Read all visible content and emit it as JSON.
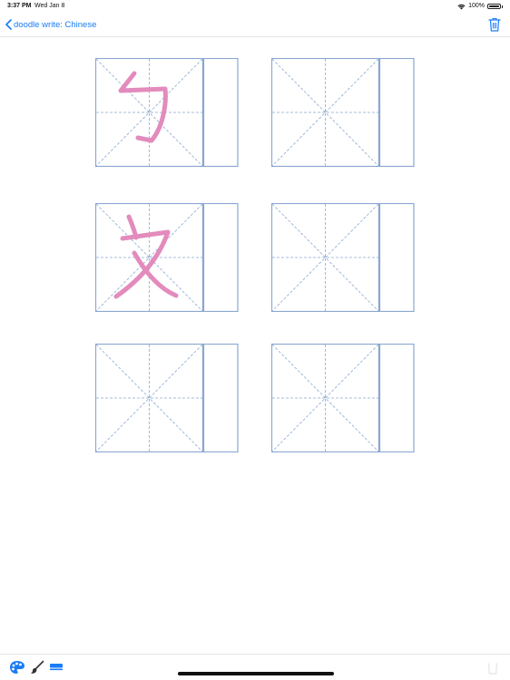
{
  "status_bar": {
    "time": "3:37 PM",
    "date": "Wed Jan 8",
    "battery": "100%"
  },
  "nav": {
    "back_label": "doodle write: Chinese"
  },
  "practice_grid": {
    "cells": [
      {
        "glyph": "勹",
        "has_drawing": true
      },
      {
        "glyph": "",
        "has_drawing": false
      },
      {
        "glyph": "又",
        "has_drawing": true
      },
      {
        "glyph": "",
        "has_drawing": false
      },
      {
        "glyph": "",
        "has_drawing": false
      },
      {
        "glyph": "",
        "has_drawing": false
      }
    ]
  },
  "toolbar": {
    "tools": [
      "palette-icon",
      "brush-icon",
      "eraser-icon",
      "trash-icon"
    ]
  },
  "colors": {
    "accent": "#1a7cf5",
    "grid_line": "#8aa8cf",
    "stroke": "#e38bbd"
  }
}
